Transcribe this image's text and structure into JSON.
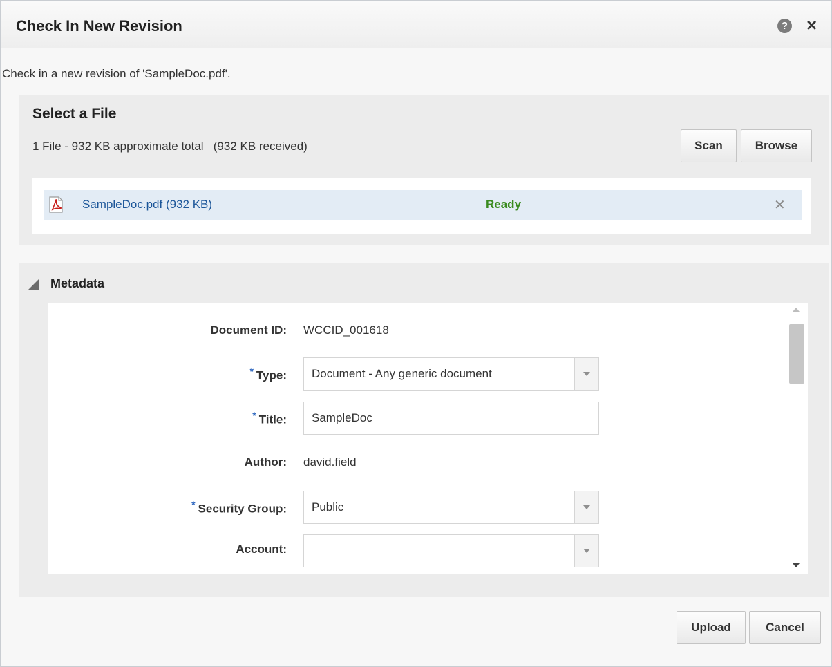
{
  "dialog": {
    "title": "Check In New Revision",
    "help_icon": "help-icon",
    "close_icon": "close-icon",
    "intro": "Check in a new revision of 'SampleDoc.pdf'."
  },
  "select_file": {
    "heading": "Select a File",
    "summary": "1 File - 932 KB approximate total   (932 KB received)",
    "scan_label": "Scan",
    "browse_label": "Browse",
    "file": {
      "icon": "pdf-file-icon",
      "name": "SampleDoc.pdf (932 KB)",
      "status": "Ready",
      "status_color": "#3a8b1f",
      "remove_icon": "remove-icon"
    }
  },
  "metadata": {
    "heading": "Metadata",
    "fields": {
      "document_id": {
        "label": "Document ID:",
        "value": "WCCID_001618"
      },
      "type": {
        "label": "Type:",
        "value": "Document - Any generic document",
        "required": true
      },
      "title": {
        "label": "Title:",
        "value": "SampleDoc",
        "required": true
      },
      "author": {
        "label": "Author:",
        "value": "david.field"
      },
      "security_group": {
        "label": "Security Group:",
        "value": "Public",
        "required": true
      },
      "account": {
        "label": "Account:",
        "value": ""
      }
    },
    "required_marker": "*"
  },
  "footer": {
    "upload_label": "Upload",
    "cancel_label": "Cancel"
  },
  "colors": {
    "link": "#1c5699",
    "required_marker": "#2f68c0",
    "selected_row": "#e3ecf5"
  }
}
